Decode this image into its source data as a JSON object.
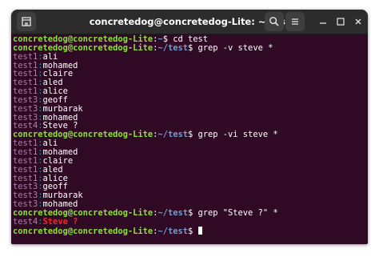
{
  "window": {
    "title": "concretedog@concretedog-Lite: ~/test",
    "icons": {
      "new_tab": "new-tab-icon",
      "search": "search-icon",
      "menu": "hamburger-menu-icon",
      "minimize": "minimize-icon",
      "maximize": "maximize-icon",
      "close": "close-icon"
    }
  },
  "colors": {
    "terminal_bg": "#300a24",
    "prompt_user": "#8ae234",
    "prompt_path": "#729fcf",
    "grep_filename": "#ad7fa8",
    "grep_separator": "#06989a",
    "grep_match": "#ef2929",
    "titlebar_bg": "#2c2c2c"
  },
  "terminal": {
    "lines": [
      {
        "type": "prompt",
        "user": "concretedog@concretedog-Lite",
        "path": "~",
        "command": "cd test"
      },
      {
        "type": "prompt",
        "user": "concretedog@concretedog-Lite",
        "path": "~/test",
        "command": "grep -v steve *"
      },
      {
        "type": "grep",
        "file": "test1",
        "text": "ali"
      },
      {
        "type": "grep",
        "file": "test1",
        "text": "mohamed"
      },
      {
        "type": "grep",
        "file": "test1",
        "text": "claire"
      },
      {
        "type": "grep",
        "file": "test1",
        "text": "aled"
      },
      {
        "type": "grep",
        "file": "test1",
        "text": "alice"
      },
      {
        "type": "grep",
        "file": "test3",
        "text": "geoff"
      },
      {
        "type": "grep",
        "file": "test3",
        "text": "murbarak"
      },
      {
        "type": "grep",
        "file": "test3",
        "text": "mohamed"
      },
      {
        "type": "grep",
        "file": "test4",
        "text": "Steve ?"
      },
      {
        "type": "prompt",
        "user": "concretedog@concretedog-Lite",
        "path": "~/test",
        "command": "grep -vi steve *"
      },
      {
        "type": "grep",
        "file": "test1",
        "text": "ali"
      },
      {
        "type": "grep",
        "file": "test1",
        "text": "mohamed"
      },
      {
        "type": "grep",
        "file": "test1",
        "text": "claire"
      },
      {
        "type": "grep",
        "file": "test1",
        "text": "aled"
      },
      {
        "type": "grep",
        "file": "test1",
        "text": "alice"
      },
      {
        "type": "grep",
        "file": "test3",
        "text": "geoff"
      },
      {
        "type": "grep",
        "file": "test3",
        "text": "murbarak"
      },
      {
        "type": "grep",
        "file": "test3",
        "text": "mohamed"
      },
      {
        "type": "prompt",
        "user": "concretedog@concretedog-Lite",
        "path": "~/test",
        "command": "grep \"Steve ?\" *"
      },
      {
        "type": "grep",
        "file": "test4",
        "text": "Steve ?",
        "match": true
      },
      {
        "type": "prompt",
        "user": "concretedog@concretedog-Lite",
        "path": "~/test",
        "command": "",
        "cursor": true
      }
    ]
  }
}
